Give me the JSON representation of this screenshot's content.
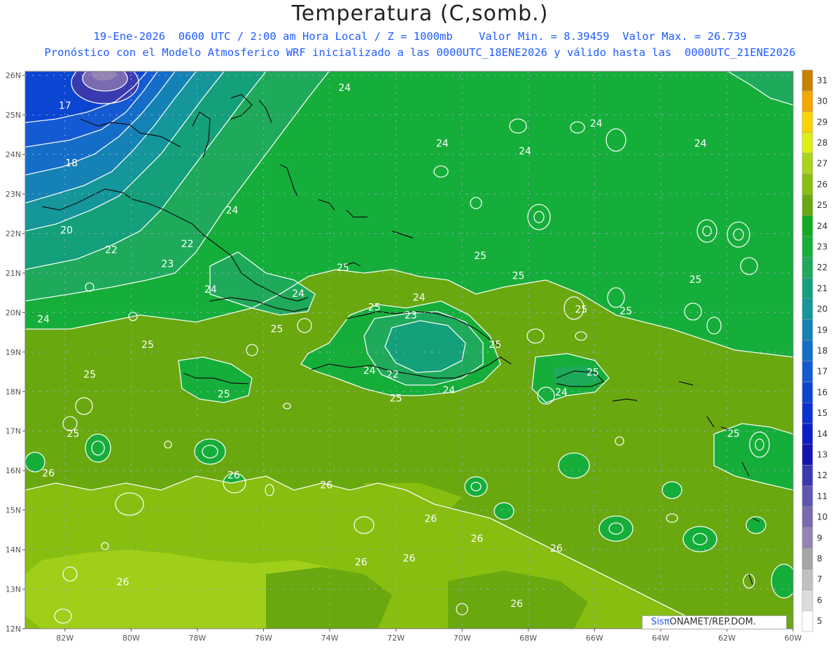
{
  "header": {
    "title": "Temperatura (C,somb.)",
    "line1": "19-Ene-2026  0600 UTC / 2:00 am Hora Local / Z = 1000mb    Valor Min. = 8.39459  Valor Max. = 26.739",
    "line2": "Pronóstico con el Modelo Atmosferico WRF inicializado a las 0000UTC_18ENE2026 y válido hasta las  0000UTC_21ENE2026"
  },
  "map": {
    "lon_labels": [
      "82W",
      "80W",
      "78W",
      "76W",
      "74W",
      "72W",
      "70W",
      "68W",
      "66W",
      "64W",
      "62W",
      "60W"
    ],
    "lat_labels": [
      "26N",
      "25N",
      "24N",
      "23N",
      "22N",
      "21N",
      "20N",
      "19N",
      "18N",
      "17N",
      "16N",
      "15N",
      "14N",
      "13N",
      "12N"
    ],
    "contour_labels": [
      {
        "text": "17",
        "lon": -82.0,
        "lat": 25.15
      },
      {
        "text": "18",
        "lon": -81.8,
        "lat": 23.7
      },
      {
        "text": "20",
        "lon": -81.95,
        "lat": 22.0
      },
      {
        "text": "22",
        "lon": -80.6,
        "lat": 21.5
      },
      {
        "text": "22",
        "lon": -78.3,
        "lat": 21.65
      },
      {
        "text": "23",
        "lon": -78.9,
        "lat": 21.15
      },
      {
        "text": "24",
        "lon": -82.65,
        "lat": 19.75
      },
      {
        "text": "24",
        "lon": -77.6,
        "lat": 20.5
      },
      {
        "text": "24",
        "lon": -76.95,
        "lat": 22.5
      },
      {
        "text": "24",
        "lon": -73.55,
        "lat": 25.6
      },
      {
        "text": "24",
        "lon": -70.6,
        "lat": 24.2
      },
      {
        "text": "24",
        "lon": -68.1,
        "lat": 24.0
      },
      {
        "text": "24",
        "lon": -65.95,
        "lat": 24.7
      },
      {
        "text": "24",
        "lon": -62.8,
        "lat": 24.2
      },
      {
        "text": "24",
        "lon": -74.95,
        "lat": 20.4
      },
      {
        "text": "24",
        "lon": -71.3,
        "lat": 20.3
      },
      {
        "text": "24",
        "lon": -72.8,
        "lat": 18.45
      },
      {
        "text": "24",
        "lon": -70.4,
        "lat": 17.95
      },
      {
        "text": "24",
        "lon": -67.0,
        "lat": 17.9
      },
      {
        "text": "23",
        "lon": -71.55,
        "lat": 19.85
      },
      {
        "text": "22",
        "lon": -72.1,
        "lat": 18.35
      },
      {
        "text": "25",
        "lon": -73.6,
        "lat": 21.05
      },
      {
        "text": "25",
        "lon": -72.65,
        "lat": 20.05
      },
      {
        "text": "25",
        "lon": -69.45,
        "lat": 21.35
      },
      {
        "text": "25",
        "lon": -68.3,
        "lat": 20.85
      },
      {
        "text": "25",
        "lon": -66.4,
        "lat": 20.0
      },
      {
        "text": "25",
        "lon": -65.05,
        "lat": 19.95
      },
      {
        "text": "25",
        "lon": -62.95,
        "lat": 20.75
      },
      {
        "text": "25",
        "lon": -75.6,
        "lat": 19.5
      },
      {
        "text": "25",
        "lon": -79.5,
        "lat": 19.1
      },
      {
        "text": "25",
        "lon": -81.25,
        "lat": 18.35
      },
      {
        "text": "25",
        "lon": -77.2,
        "lat": 17.85
      },
      {
        "text": "25",
        "lon": -72.0,
        "lat": 17.75
      },
      {
        "text": "25",
        "lon": -69.0,
        "lat": 19.1
      },
      {
        "text": "25",
        "lon": -66.05,
        "lat": 18.4
      },
      {
        "text": "25",
        "lon": -61.8,
        "lat": 16.85
      },
      {
        "text": "25",
        "lon": -81.75,
        "lat": 16.85
      },
      {
        "text": "26",
        "lon": -82.5,
        "lat": 15.85
      },
      {
        "text": "26",
        "lon": -76.9,
        "lat": 15.8
      },
      {
        "text": "26",
        "lon": -74.1,
        "lat": 15.55
      },
      {
        "text": "26",
        "lon": -70.95,
        "lat": 14.7
      },
      {
        "text": "26",
        "lon": -69.55,
        "lat": 14.2
      },
      {
        "text": "26",
        "lon": -73.05,
        "lat": 13.6
      },
      {
        "text": "26",
        "lon": -71.6,
        "lat": 13.7
      },
      {
        "text": "26",
        "lon": -67.15,
        "lat": 13.95
      },
      {
        "text": "26",
        "lon": -80.25,
        "lat": 13.1
      },
      {
        "text": "26",
        "lon": -68.35,
        "lat": 12.55
      }
    ]
  },
  "legend": {
    "levels": [
      "5",
      "6",
      "7",
      "8",
      "9",
      "10",
      "11",
      "12",
      "13",
      "14",
      "15",
      "16",
      "17",
      "18",
      "19",
      "20",
      "21",
      "22",
      "23",
      "24",
      "25",
      "26",
      "27",
      "28",
      "29",
      "30",
      "31"
    ],
    "colors": [
      "#ffffff",
      "#dcdcdc",
      "#c0c0c0",
      "#a6a6a6",
      "#9484b4",
      "#7a6ab0",
      "#5e56b0",
      "#3a3ab0",
      "#1414b4",
      "#0a1ec8",
      "#0a32d2",
      "#0a46d2",
      "#145ad2",
      "#146ec8",
      "#1482b4",
      "#14969a",
      "#14a07a",
      "#1eaa5a",
      "#16ae3a",
      "#12aa22",
      "#6aa810",
      "#88be10",
      "#a8d41e",
      "#e0ee14",
      "#ffd200",
      "#f2a800",
      "#c88200"
    ]
  },
  "credit": {
    "sis": "Sisπ",
    "rest": "ONAMET/REP.DOM."
  }
}
